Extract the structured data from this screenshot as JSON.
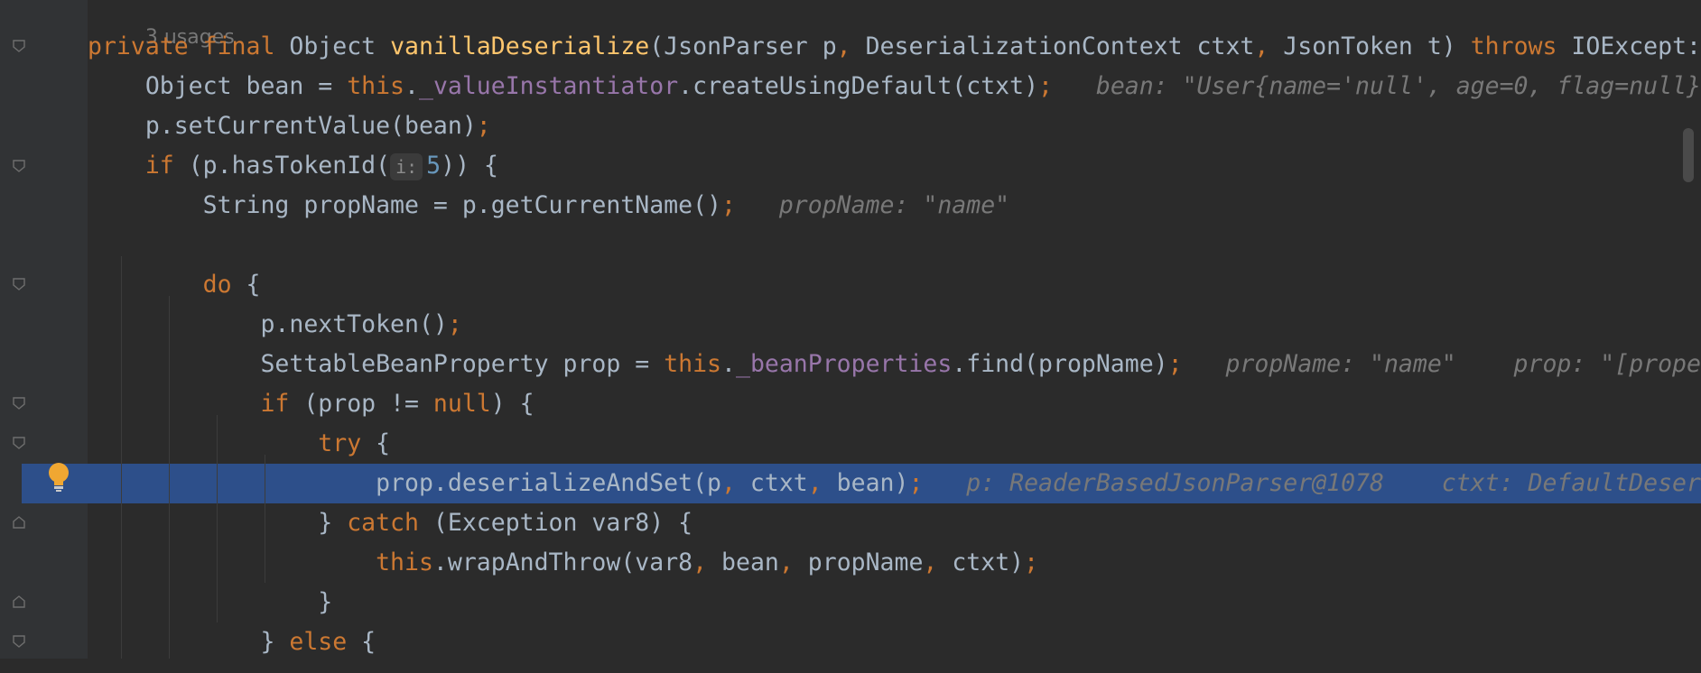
{
  "editor": {
    "usages_label": "3 usages",
    "lines": [
      {
        "tokens": [
          {
            "t": "private final ",
            "c": "kw"
          },
          {
            "t": "Object ",
            "c": ""
          },
          {
            "t": "vanillaDeserialize",
            "c": "fn"
          },
          {
            "t": "(JsonParser p",
            "c": ""
          },
          {
            "t": ", ",
            "c": "kw"
          },
          {
            "t": "DeserializationContext ctxt",
            "c": ""
          },
          {
            "t": ", ",
            "c": "kw"
          },
          {
            "t": "JsonToken t) ",
            "c": ""
          },
          {
            "t": "throws ",
            "c": "kw"
          },
          {
            "t": "IOExcept:",
            "c": ""
          }
        ]
      },
      {
        "tokens": [
          {
            "t": "    Object bean = ",
            "c": ""
          },
          {
            "t": "this",
            "c": "kw"
          },
          {
            "t": ".",
            "c": ""
          },
          {
            "t": "_valueInstantiator",
            "c": "fld"
          },
          {
            "t": ".createUsingDefault(ctxt)",
            "c": ""
          },
          {
            "t": ";",
            "c": "kw"
          },
          {
            "t": "   bean: \"User{name='null', age=0, flag=null}",
            "c": "hint"
          }
        ]
      },
      {
        "tokens": [
          {
            "t": "    p.setCurrentValue(bean)",
            "c": ""
          },
          {
            "t": ";",
            "c": "kw"
          }
        ]
      },
      {
        "tokens": [
          {
            "t": "    ",
            "c": ""
          },
          {
            "t": "if ",
            "c": "kw"
          },
          {
            "t": "(p.hasTokenId(",
            "c": ""
          },
          {
            "t": "i:",
            "c": "param"
          },
          {
            "t": "5",
            "c": "num"
          },
          {
            "t": ")) {",
            "c": ""
          }
        ]
      },
      {
        "tokens": [
          {
            "t": "        String propName = p.getCurrentName()",
            "c": ""
          },
          {
            "t": ";",
            "c": "kw"
          },
          {
            "t": "   propName: \"name\"",
            "c": "hint"
          }
        ]
      },
      {
        "tokens": []
      },
      {
        "tokens": [
          {
            "t": "        ",
            "c": ""
          },
          {
            "t": "do ",
            "c": "kw"
          },
          {
            "t": "{",
            "c": ""
          }
        ]
      },
      {
        "tokens": [
          {
            "t": "            p.nextToken()",
            "c": ""
          },
          {
            "t": ";",
            "c": "kw"
          }
        ]
      },
      {
        "tokens": [
          {
            "t": "            SettableBeanProperty prop = ",
            "c": ""
          },
          {
            "t": "this",
            "c": "kw"
          },
          {
            "t": ".",
            "c": ""
          },
          {
            "t": "_beanProperties",
            "c": "fld"
          },
          {
            "t": ".find(propName)",
            "c": ""
          },
          {
            "t": ";",
            "c": "kw"
          },
          {
            "t": "   propName: \"name\"    prop: \"[prope",
            "c": "hint"
          }
        ]
      },
      {
        "tokens": [
          {
            "t": "            ",
            "c": ""
          },
          {
            "t": "if ",
            "c": "kw"
          },
          {
            "t": "(prop != ",
            "c": ""
          },
          {
            "t": "null",
            "c": "kw"
          },
          {
            "t": ") {",
            "c": ""
          }
        ]
      },
      {
        "tokens": [
          {
            "t": "                ",
            "c": ""
          },
          {
            "t": "try ",
            "c": "kw"
          },
          {
            "t": "{",
            "c": ""
          }
        ]
      },
      {
        "highlight": true,
        "tokens": [
          {
            "t": "                    prop.deserializeAndSet(p",
            "c": ""
          },
          {
            "t": ", ",
            "c": "kw"
          },
          {
            "t": "ctxt",
            "c": ""
          },
          {
            "t": ", ",
            "c": "kw"
          },
          {
            "t": "bean)",
            "c": ""
          },
          {
            "t": ";",
            "c": "kw"
          },
          {
            "t": "   p: ReaderBasedJsonParser@1078    ctxt: DefaultDeser",
            "c": "hint"
          }
        ]
      },
      {
        "tokens": [
          {
            "t": "                } ",
            "c": ""
          },
          {
            "t": "catch ",
            "c": "kw"
          },
          {
            "t": "(Exception var8) {",
            "c": ""
          }
        ]
      },
      {
        "tokens": [
          {
            "t": "                    ",
            "c": ""
          },
          {
            "t": "this",
            "c": "kw"
          },
          {
            "t": ".wrapAndThrow(var8",
            "c": ""
          },
          {
            "t": ", ",
            "c": "kw"
          },
          {
            "t": "bean",
            "c": ""
          },
          {
            "t": ", ",
            "c": "kw"
          },
          {
            "t": "propName",
            "c": ""
          },
          {
            "t": ", ",
            "c": "kw"
          },
          {
            "t": "ctxt)",
            "c": ""
          },
          {
            "t": ";",
            "c": "kw"
          }
        ]
      },
      {
        "tokens": [
          {
            "t": "                }",
            "c": ""
          }
        ]
      },
      {
        "tokens": [
          {
            "t": "            } ",
            "c": ""
          },
          {
            "t": "else ",
            "c": "kw"
          },
          {
            "t": "{",
            "c": ""
          }
        ]
      }
    ]
  },
  "colors": {
    "background": "#2b2b2b",
    "highlight": "#2d4f8a",
    "keyword": "#cc7832",
    "method": "#ffc66d",
    "field": "#9876aa",
    "number": "#6897bb",
    "hint": "#787878"
  },
  "icons": {
    "bulb": "lightbulb-icon",
    "fold": "fold-marker-icon"
  }
}
